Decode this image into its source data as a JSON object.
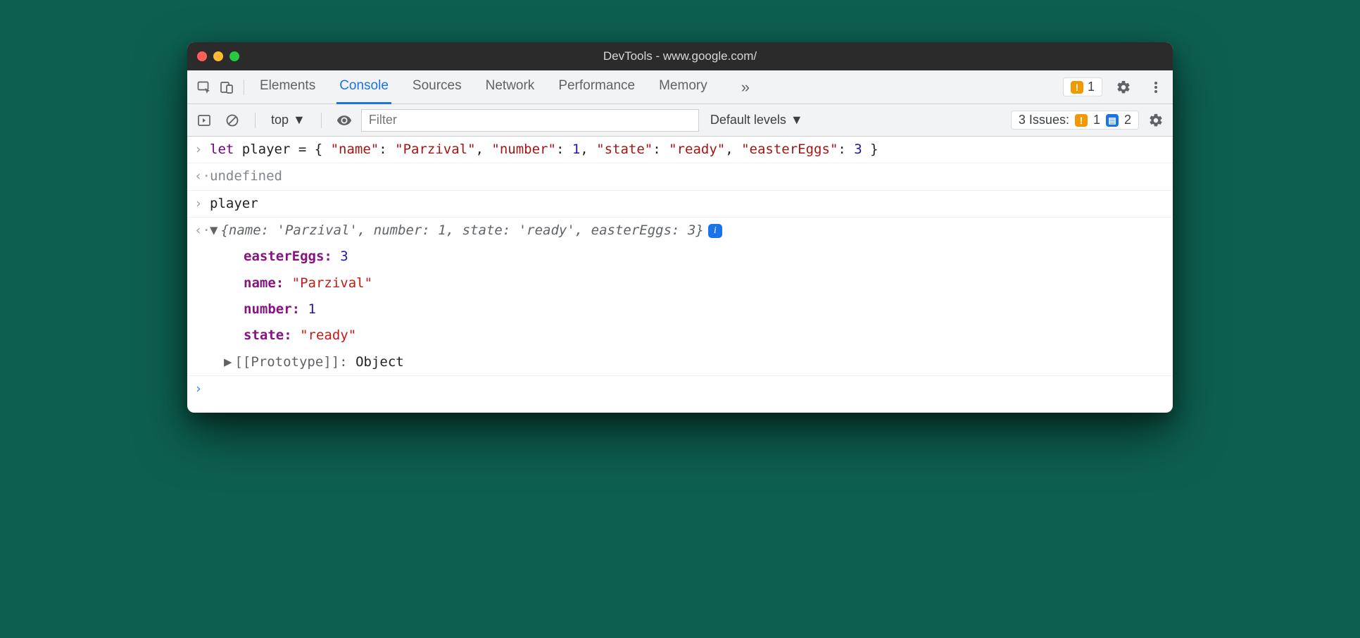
{
  "window": {
    "title": "DevTools - www.google.com/"
  },
  "tabs": {
    "items": [
      "Elements",
      "Console",
      "Sources",
      "Network",
      "Performance",
      "Memory"
    ],
    "active": "Console",
    "more_glyph": "»",
    "warning_count": "1"
  },
  "toolbar": {
    "context": "top",
    "filter_placeholder": "Filter",
    "levels": "Default levels",
    "issues_label": "3 Issues:",
    "issues_warn": "1",
    "issues_info": "2"
  },
  "console": {
    "line1": {
      "kw": "let",
      "varname": " player = { ",
      "k1": "\"name\"",
      "v1": "\"Parzival\"",
      "k2": "\"number\"",
      "v2": "1",
      "k3": "\"state\"",
      "v3": "\"ready\"",
      "k4": "\"easterEggs\"",
      "v4": "3",
      "close": " }"
    },
    "undefined": "undefined",
    "line2": "player",
    "summary": "{name: 'Parzival', number: 1, state: 'ready', easterEggs: 3}",
    "props": {
      "p1k": "easterEggs",
      "p1v": "3",
      "p2k": "name",
      "p2v": "\"Parzival\"",
      "p3k": "number",
      "p3v": "1",
      "p4k": "state",
      "p4v": "\"ready\""
    },
    "proto_label": "[[Prototype]]",
    "proto_value": "Object"
  }
}
